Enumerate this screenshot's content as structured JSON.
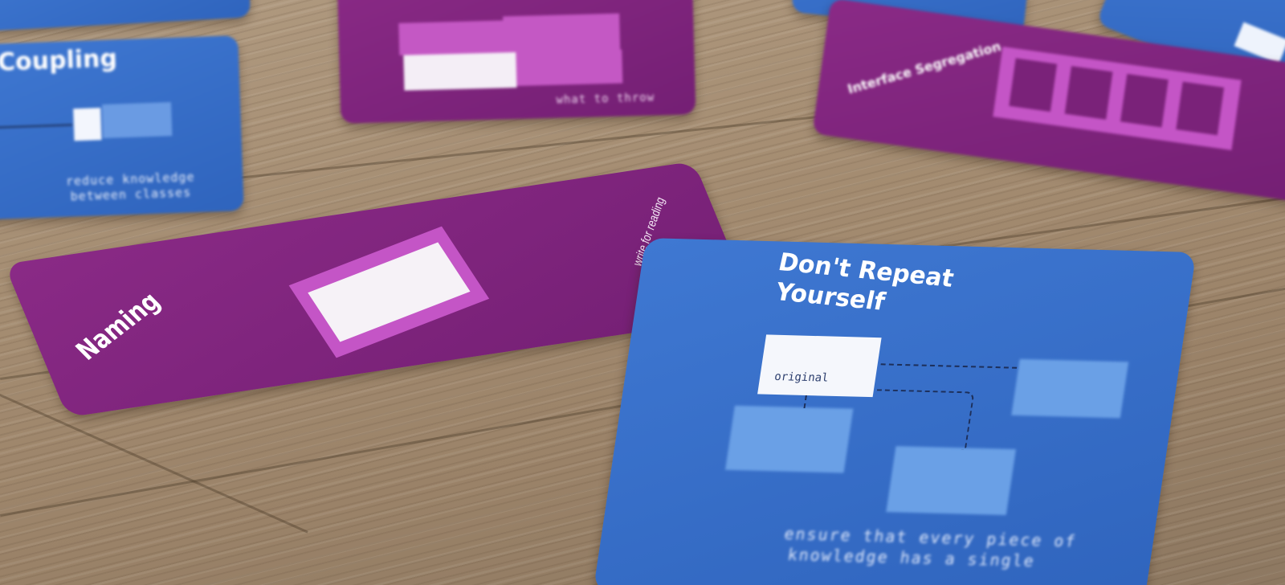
{
  "scene": {
    "description_color": {
      "wood": "#a48c71",
      "blue_card": "#3b72cf",
      "purple_card": "#7f2580",
      "accent_pink": "#c455c6"
    }
  },
  "cards": {
    "coupling": {
      "title": "Coupling",
      "subtitle_line1": "reduce knowledge",
      "subtitle_line2": "between classes"
    },
    "naming": {
      "title": "Naming",
      "subtitle": "write for reading"
    },
    "dry": {
      "title_line1": "Don't Repeat",
      "title_line2": "Yourself",
      "box_label": "original",
      "subtitle_line1": "ensure that every piece of",
      "subtitle_line2": "knowledge has a single"
    },
    "top_purple": {
      "subtitle": "what to throw"
    },
    "right_purple": {
      "title": "Interface Segregation"
    }
  }
}
